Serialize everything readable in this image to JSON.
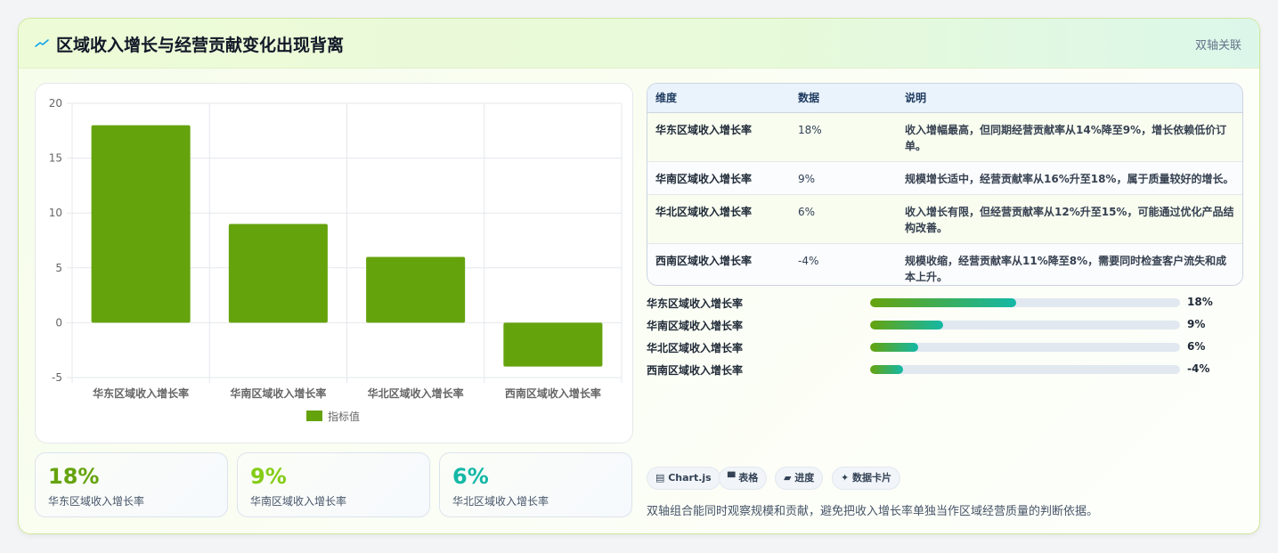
{
  "header": {
    "icon": "trend-line-icon",
    "title": "区域收入增长与经营贡献变化出现背离",
    "tag": "双轴关联"
  },
  "colors": {
    "bar": "#65a30d",
    "accent_teal": "#14b8a6",
    "kpi_green": "#65a30d",
    "kpi_lime": "#84cc16",
    "kpi_teal": "#14b8a6"
  },
  "chart_data": {
    "type": "bar",
    "categories": [
      "华东区域收入增长率",
      "华南区域收入增长率",
      "华北区域收入增长率",
      "西南区域收入增长率"
    ],
    "series": [
      {
        "name": "指标值",
        "values": [
          18,
          9,
          6,
          -4
        ]
      }
    ],
    "ylim": [
      -5,
      20
    ],
    "yticks": [
      20,
      15,
      10,
      5,
      0,
      -5
    ],
    "grid": true,
    "legend": "bottom"
  },
  "table": {
    "headers": [
      "维度",
      "数据",
      "说明"
    ],
    "rows": [
      {
        "dimension": "华东区域收入增长率",
        "value": "18%",
        "note": "收入增幅最高，但同期经营贡献率从14%降至9%，增长依赖低价订单。"
      },
      {
        "dimension": "华南区域收入增长率",
        "value": "9%",
        "note": "规模增长适中，经营贡献率从16%升至18%，属于质量较好的增长。"
      },
      {
        "dimension": "华北区域收入增长率",
        "value": "6%",
        "note": "收入增长有限，但经营贡献率从12%升至15%，可能通过优化产品结构改善。"
      },
      {
        "dimension": "西南区域收入增长率",
        "value": "-4%",
        "note": "规模收缩，经营贡献率从11%降至8%，需要同时检查客户流失和成本上升。"
      }
    ]
  },
  "progress": [
    {
      "label": "华东区域收入增长率",
      "value": "18%",
      "fill": 0.47
    },
    {
      "label": "华南区域收入增长率",
      "value": "9%",
      "fill": 0.235
    },
    {
      "label": "华北区域收入增长率",
      "value": "6%",
      "fill": 0.155
    },
    {
      "label": "西南区域收入增长率",
      "value": "-4%",
      "fill": 0.105
    }
  ],
  "kpis": [
    {
      "value": "18%",
      "label": "华东区域收入增长率"
    },
    {
      "value": "9%",
      "label": "华南区域收入增长率"
    },
    {
      "value": "6%",
      "label": "华北区域收入增长率"
    }
  ],
  "chips": [
    {
      "icon": "chart-icon",
      "label": "▤ Chart.js"
    },
    {
      "icon": "table-icon",
      "label": "▀ 表格"
    },
    {
      "icon": "progress-icon",
      "label": "▰ 进度"
    },
    {
      "icon": "sparkle-icon",
      "label": "✦ 数据卡片"
    }
  ],
  "footnote": "双轴组合能同时观察规模和贡献，避免把收入增长率单独当作区域经营质量的判断依据。"
}
